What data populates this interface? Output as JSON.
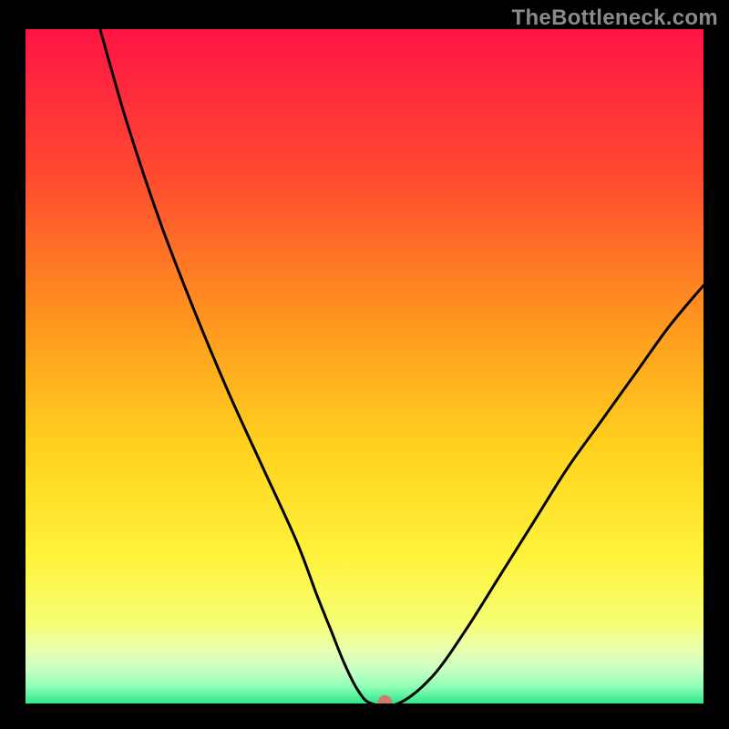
{
  "watermark": "TheBottleneck.com",
  "chart_data": {
    "type": "line",
    "title": "",
    "xlabel": "",
    "ylabel": "",
    "xlim": [
      0,
      100
    ],
    "ylim": [
      0,
      100
    ],
    "grid": false,
    "legend": false,
    "series": [
      {
        "name": "curve",
        "x": [
          11,
          15,
          20,
          25,
          30,
          35,
          40,
          43,
          45,
          47,
          49,
          51,
          55,
          60,
          65,
          70,
          75,
          80,
          85,
          90,
          95,
          100
        ],
        "y": [
          100,
          86,
          71,
          58,
          46,
          35,
          24,
          16,
          11,
          6,
          2,
          0,
          0,
          4,
          11,
          19,
          27,
          35,
          42,
          49,
          56,
          62
        ]
      }
    ],
    "marker": {
      "x": 53,
      "y": 0
    },
    "background": {
      "type": "vertical-gradient",
      "stops": [
        {
          "pos": 0.0,
          "color": "#ff1445"
        },
        {
          "pos": 0.22,
          "color": "#ff4b2f"
        },
        {
          "pos": 0.45,
          "color": "#ff9c1e"
        },
        {
          "pos": 0.62,
          "color": "#ffd21e"
        },
        {
          "pos": 0.78,
          "color": "#fff23a"
        },
        {
          "pos": 0.88,
          "color": "#f6ff73"
        },
        {
          "pos": 0.92,
          "color": "#eaffb0"
        },
        {
          "pos": 0.95,
          "color": "#c8ffc4"
        },
        {
          "pos": 0.975,
          "color": "#8effb4"
        },
        {
          "pos": 1.0,
          "color": "#2fe58b"
        }
      ]
    }
  }
}
